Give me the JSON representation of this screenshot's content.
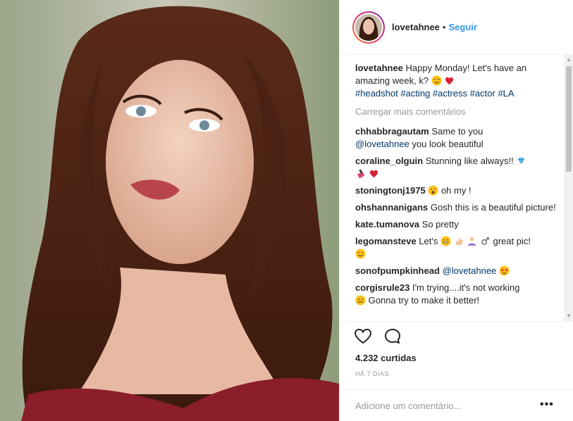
{
  "header": {
    "username": "lovetahnee",
    "separator": "•",
    "follow_label": "Seguir"
  },
  "caption": {
    "username": "lovetahnee",
    "text": "Happy Monday! Let's have an amazing week, k?",
    "hashtags": [
      "#headshot",
      "#acting",
      "#actress",
      "#actor",
      "#LA"
    ]
  },
  "load_more_label": "Carregar mais comentários",
  "comments": [
    {
      "user": "chhabbragautam",
      "text": "Same to you",
      "mention": "@lovetahnee",
      "after": "you look beautiful"
    },
    {
      "user": "coraline_olguin",
      "text": "Stunning like always!!"
    },
    {
      "user": "stoningtonj1975",
      "text": "oh my !"
    },
    {
      "user": "ohshannanigans",
      "text": "Gosh this is a beautiful picture!"
    },
    {
      "user": "kate.tumanova",
      "text": "So pretty"
    },
    {
      "user": "legomansteve",
      "text": "Let's",
      "after": "great pic!"
    },
    {
      "user": "sonofpumpkinhead",
      "mention": "@lovetahnee"
    },
    {
      "user": "corgisrule23",
      "text": "I'm trying....it's not working",
      "after": "Gonna try to make it better!"
    }
  ],
  "likes": "4.232 curtidas",
  "time": "HÁ 7 DIAS",
  "add_comment_placeholder": "Adicione um comentário...",
  "more_label": "•••",
  "icons": {
    "like": "heart-icon",
    "comment": "comment-icon",
    "more": "more-options-icon"
  },
  "colors": {
    "link": "#3897f0",
    "hashtag": "#003569",
    "muted": "#999999"
  }
}
